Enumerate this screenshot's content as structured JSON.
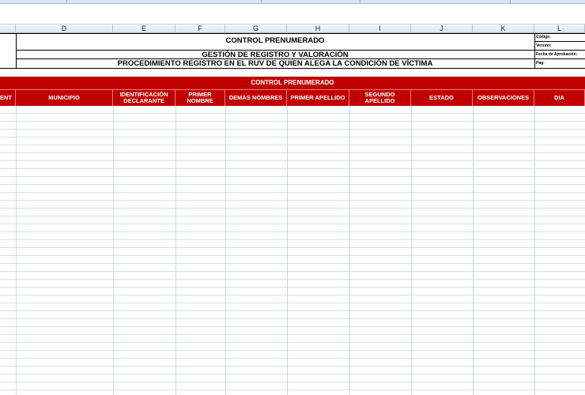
{
  "columns": [
    "D",
    "E",
    "F",
    "G",
    "H",
    "I",
    "J",
    "K",
    "L"
  ],
  "titles": {
    "main": "CONTROL PRENUMERADO",
    "process": "GESTIÓN DE REGISTRO Y VALORACIÓN",
    "procedure": "PROCEDIMIENTO REGISTRO EN EL RUV DE QUIEN ALEGA LA CONDICIÓN DE VÍCTIMA"
  },
  "meta_labels": [
    "Código:",
    "Versión:",
    "Fecha de Aprobación:",
    "Pág:"
  ],
  "banner": "CONTROL PRENUMERADO",
  "headers": [
    "ENT",
    "MUNICIPIO",
    "IDENTIFICACIÓN DECLARANTE",
    "PRIMER NOMBRE",
    "DEMÁS NOMBRES",
    "PRIMER APELLIDO",
    "SEGUNDO APELLIDO",
    "ESTADO",
    "OBSERVACIONES",
    "DIA"
  ]
}
